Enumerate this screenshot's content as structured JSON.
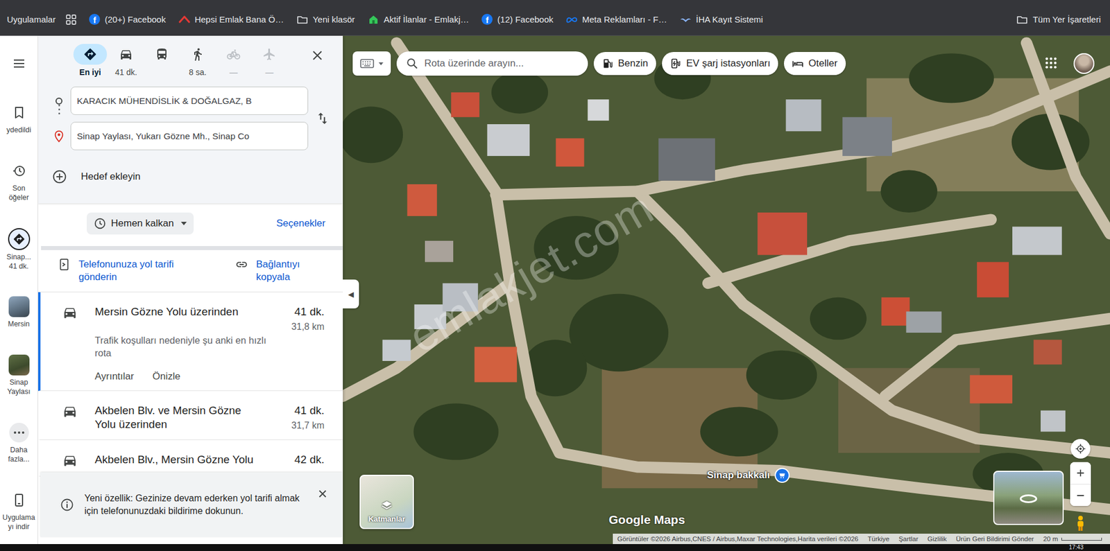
{
  "bookmarks_bar": {
    "apps_label": "Uygulamalar",
    "items": [
      {
        "label": "(20+) Facebook",
        "kind": "facebook",
        "glyph": "f"
      },
      {
        "label": "Hepsi Emlak Bana Ö…",
        "kind": "hepsiemlak"
      },
      {
        "label": "Yeni klasör",
        "kind": "folder"
      },
      {
        "label": "Aktif İlanlar - Emlakj…",
        "kind": "emlakjet"
      },
      {
        "label": "(12) Facebook",
        "kind": "facebook",
        "glyph": "f"
      },
      {
        "label": "Meta Reklamları - F…",
        "kind": "meta"
      },
      {
        "label": "İHA Kayıt Sistemi",
        "kind": "iha"
      }
    ],
    "all_bookmarks": "Tüm Yer İşaretleri"
  },
  "rail": [
    {
      "kind": "menu",
      "lines": [],
      "selected": false
    },
    {
      "kind": "saved",
      "lines": [
        "ydedildi"
      ],
      "selected": false
    },
    {
      "kind": "recent",
      "lines": [
        "Son",
        "öğeler"
      ],
      "selected": false
    },
    {
      "kind": "directions",
      "lines": [
        "Sinap...",
        "41 dk."
      ],
      "selected": true
    },
    {
      "kind": "city",
      "lines": [
        "Mersin"
      ],
      "selected": false
    },
    {
      "kind": "place",
      "lines": [
        "Sinap",
        "Yaylası"
      ],
      "selected": false
    },
    {
      "kind": "more",
      "lines": [
        "Daha",
        "fazla..."
      ],
      "selected": false
    },
    {
      "kind": "download",
      "lines": [
        "Uygulama",
        "yı indir"
      ],
      "selected": false
    }
  ],
  "panel": {
    "modes": [
      {
        "kind": "best",
        "label": "En iyi",
        "selected": true,
        "disabled": false
      },
      {
        "kind": "car",
        "label": "41 dk.",
        "selected": false,
        "disabled": false
      },
      {
        "kind": "transit",
        "selected": false,
        "disabled": false
      },
      {
        "kind": "walk",
        "label": "8 sa.",
        "selected": false,
        "disabled": false
      },
      {
        "kind": "bike",
        "label": "—",
        "selected": false,
        "disabled": true
      },
      {
        "kind": "flight",
        "label": "—",
        "selected": false,
        "disabled": true
      }
    ],
    "origin": "KARACIK MÜHENDİSLİK & DOĞALGAZ, B",
    "destination": "Sinap Yaylası, Yukarı Gözne Mh., Sinap Co",
    "add_stop": "Hedef ekleyin",
    "departure": "Hemen kalkan",
    "options": "Seçenekler",
    "send_to_phone": "Telefonunuza yol tarifi gönderin",
    "copy_link": "Bağlantıyı kopyala",
    "routes": [
      {
        "title": "Mersin Gözne Yolu üzerinden",
        "time": "41 dk.",
        "distance": "31,8 km",
        "note": "Trafik koşulları nedeniyle şu anki en hızlı rota",
        "actions": [
          "Ayrıntılar",
          "Önizle"
        ],
        "selected": true
      },
      {
        "title": "Akbelen Blv. ve Mersin Gözne Yolu üzerinden",
        "time": "41 dk.",
        "distance": "31,7 km",
        "actions": [],
        "selected": false
      },
      {
        "title": "Akbelen Blv., Mersin Gözne Yolu",
        "time": "42 dk.",
        "actions": [],
        "selected": false
      }
    ],
    "toast": "Yeni özellik: Gezinize devam ederken yol tarifi almak için telefonunuzdaki bildirime dokunun.",
    "collapse": "◀"
  },
  "map": {
    "search_placeholder": "Rota üzerinde arayın...",
    "chips": [
      {
        "label": "Benzin",
        "kind": "gas"
      },
      {
        "label": "EV şarj istasyonları",
        "kind": "ev"
      },
      {
        "label": "Oteller",
        "kind": "hotel"
      }
    ],
    "watermark": "emlakjet.com",
    "place_label": "Sinap bakkalı",
    "logo": "Google Maps",
    "layers": "Katmanlar",
    "footer": {
      "attribution": "Görüntüler ©2026 Airbus,CNES / Airbus,Maxar Technologies,Harita verileri ©2026",
      "links": [
        "Türkiye",
        "Şartlar",
        "Gizlilik",
        "Ürün Geri Bildirimi Gönder"
      ],
      "scale": "20 m"
    }
  },
  "taskbar": {
    "time": "17:43"
  }
}
